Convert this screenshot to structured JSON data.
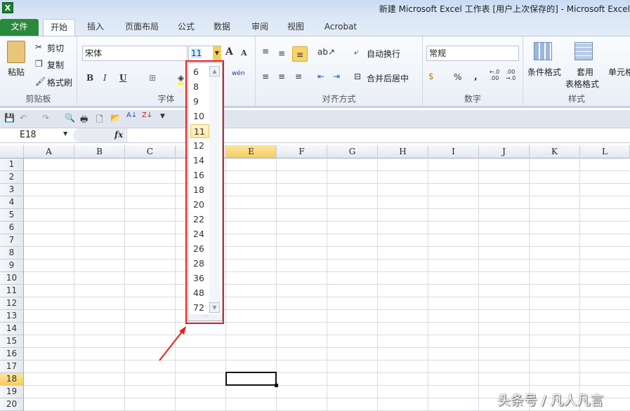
{
  "title": "新建 Microsoft Excel 工作表 [用户上次保存的]  -  Microsoft Excel",
  "tabs": [
    "文件",
    "开始",
    "插入",
    "页面布局",
    "公式",
    "数据",
    "审阅",
    "视图",
    "Acrobat"
  ],
  "clipboard": {
    "paste": "粘贴",
    "cut": "剪切",
    "copy": "复制",
    "format_painter": "格式刷",
    "label": "剪贴板"
  },
  "font": {
    "name": "宋体",
    "size": "11",
    "label": "字体",
    "bold": "B",
    "italic": "I",
    "underline": "U",
    "phonetic": "wén"
  },
  "alignment": {
    "wrap": "自动换行",
    "merge": "合并后居中",
    "label": "对齐方式"
  },
  "number": {
    "format": "常规",
    "percent": "%",
    "comma": ",",
    "inc": "←.0 .00",
    "dec": ".00 →.0",
    "label": "数字"
  },
  "styles": {
    "conditional": "条件格式",
    "table1": "套用",
    "table2": "表格格式",
    "cell": "单元格",
    "label": "样式"
  },
  "formula": {
    "name_box": "E18",
    "fx": "fx",
    "value": ""
  },
  "columns": [
    "A",
    "B",
    "C",
    "D",
    "E",
    "F",
    "G",
    "H",
    "I",
    "J",
    "K",
    "L"
  ],
  "rows": [
    "1",
    "2",
    "3",
    "4",
    "5",
    "6",
    "7",
    "8",
    "9",
    "10",
    "11",
    "12",
    "13",
    "14",
    "15",
    "16",
    "17",
    "18",
    "19",
    "20"
  ],
  "selected": {
    "column": "E",
    "row": "18"
  },
  "font_sizes": [
    "6",
    "8",
    "9",
    "10",
    "11",
    "12",
    "14",
    "16",
    "18",
    "20",
    "22",
    "24",
    "26",
    "28",
    "36",
    "48",
    "72"
  ],
  "watermark": "头条号 / 凡人凡言",
  "colors": {
    "file_tab": "#2a8a3c",
    "highlight": "#ee1c1c",
    "selected_header": "#f6cd5f"
  }
}
